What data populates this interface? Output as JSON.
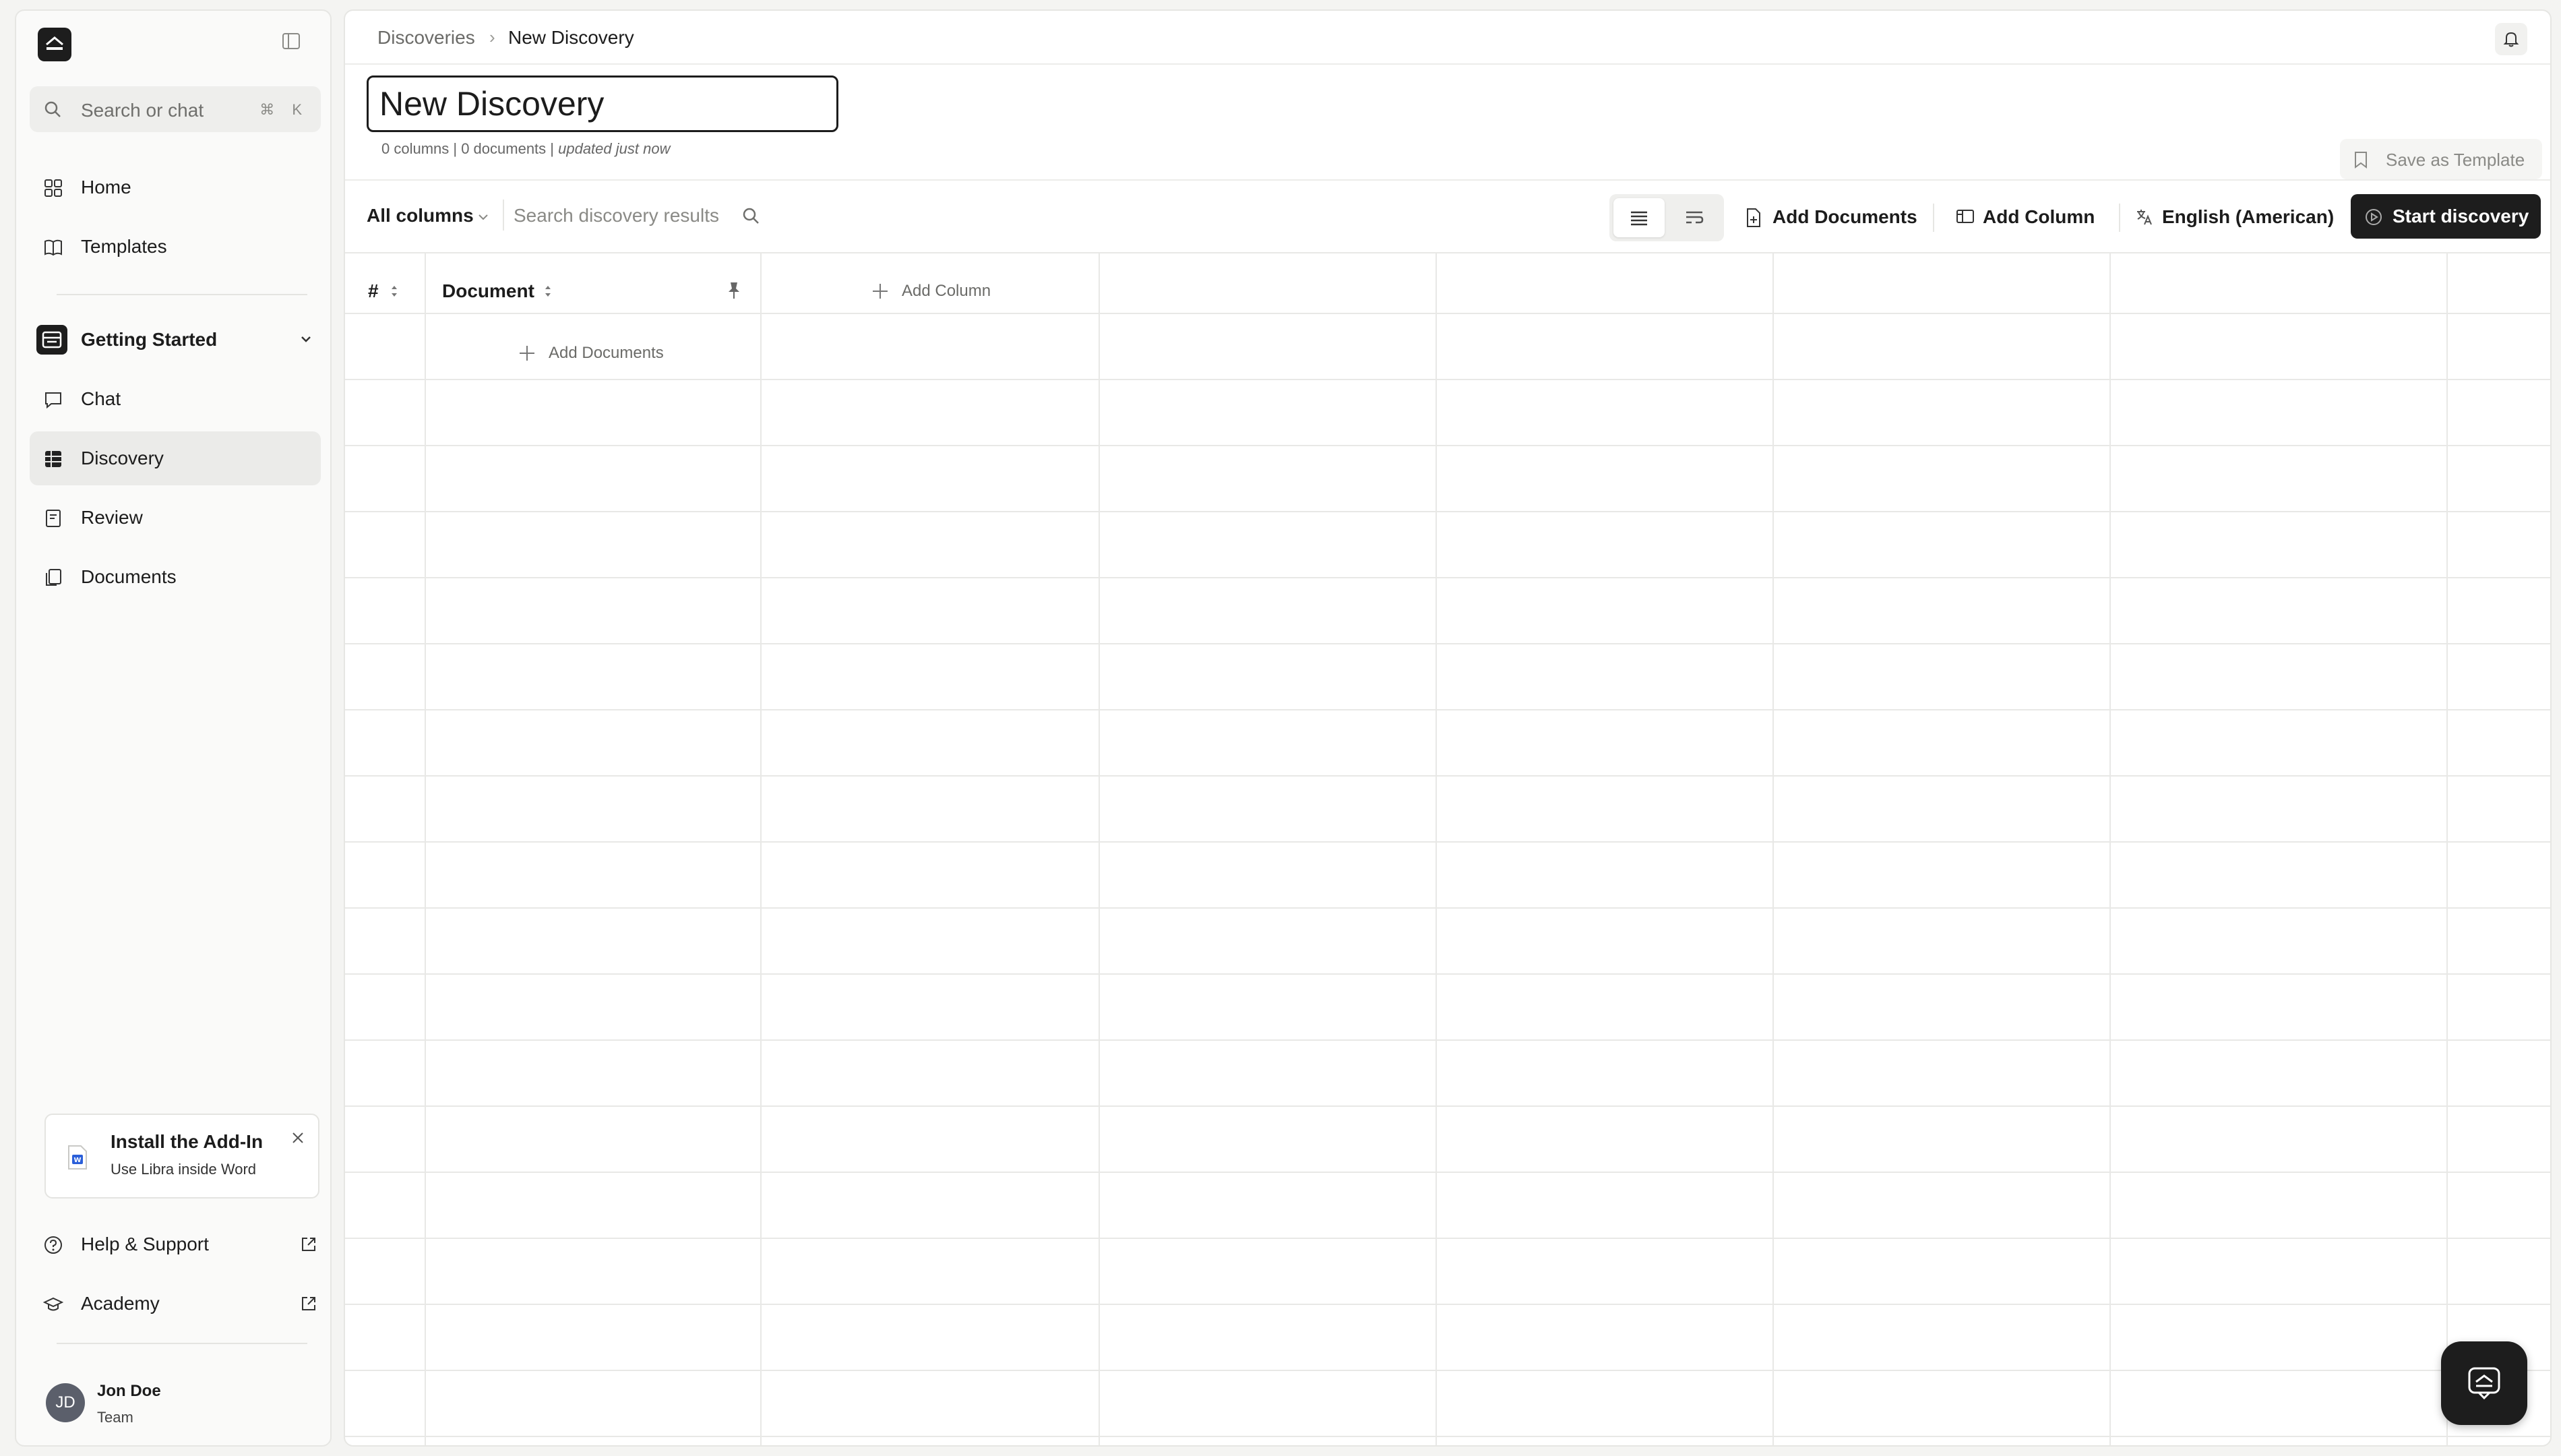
{
  "sidebar": {
    "search": {
      "placeholder": "Search or chat",
      "shortcut": "⌘ K"
    },
    "nav": [
      {
        "label": "Home",
        "icon": "grid-icon"
      },
      {
        "label": "Templates",
        "icon": "book-icon"
      }
    ],
    "group": {
      "label": "Getting Started",
      "items": [
        {
          "label": "Chat",
          "icon": "chat-icon"
        },
        {
          "label": "Discovery",
          "icon": "table-icon",
          "active": true
        },
        {
          "label": "Review",
          "icon": "review-icon"
        },
        {
          "label": "Documents",
          "icon": "documents-icon"
        }
      ]
    },
    "addin": {
      "title": "Install the Add-In",
      "subtitle": "Use Libra inside Word"
    },
    "footer": [
      {
        "label": "Help & Support",
        "icon": "help-icon"
      },
      {
        "label": "Academy",
        "icon": "academy-icon"
      }
    ],
    "user": {
      "initials": "JD",
      "name": "Jon Doe",
      "team": "Team"
    }
  },
  "header": {
    "breadcrumb": [
      "Discoveries",
      "New Discovery"
    ],
    "separator": "›"
  },
  "discovery": {
    "title": "New Discovery",
    "meta_counts": "0 columns | 0 documents | ",
    "meta_updated": "updated just now",
    "save_template": "Save as Template"
  },
  "toolbar": {
    "column_filter": "All columns",
    "search_placeholder": "Search discovery results",
    "add_documents": "Add Documents",
    "add_column": "Add Column",
    "language": "English (American)",
    "start": "Start discovery"
  },
  "table": {
    "headers": {
      "index": "#",
      "document": "Document",
      "add_column": "Add Column"
    },
    "add_documents_row": "Add Documents",
    "rows": []
  },
  "colors": {
    "accent_dark": "#1d1d1d",
    "background": "#f4f4f2",
    "active_nav": "#ebebe9",
    "word_blue": "#2b5fd9"
  }
}
